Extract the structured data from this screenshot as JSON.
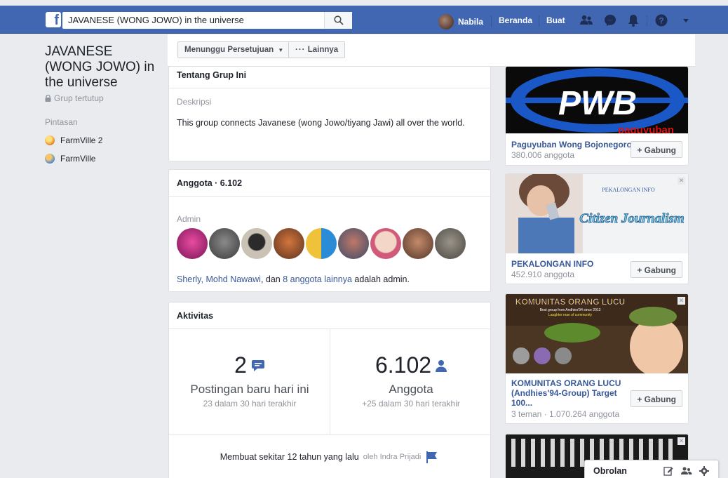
{
  "topbar": {
    "logo": "f",
    "search_value": "JAVANESE (WONG JOWO) in the universe",
    "profile_name": "Nabila",
    "nav_home": "Beranda",
    "nav_create": "Buat",
    "icons": [
      "search-icon",
      "friends-icon",
      "messenger-icon",
      "notifications-icon",
      "help-icon",
      "dropdown-caret-icon"
    ]
  },
  "left": {
    "group_title": "JAVANESE (WONG JOWO) in the universe",
    "group_type": "Grup tertutup",
    "shortcuts_heading": "Pintasan",
    "shortcuts": [
      {
        "label": "FarmVille 2",
        "icon": "farmville2-icon"
      },
      {
        "label": "FarmVille",
        "icon": "farmville-icon"
      }
    ]
  },
  "actions": {
    "pending_button": "Menunggu Persetujuan",
    "more_button": "Lainnya"
  },
  "about": {
    "heading": "Tentang Grup Ini",
    "desc_label": "Deskripsi",
    "desc_text": "This group connects Javanese (wong Jowo/tiyang Jawi) all over the world."
  },
  "members": {
    "heading": "Anggota · 6.102",
    "admin_label": "Admin",
    "admin_names": "Sherly, Mohd Nawawi",
    "and_text": ", dan ",
    "others_link": "8 anggota lainnya",
    "suffix": " adalah admin."
  },
  "activity": {
    "heading": "Aktivitas",
    "posts_count": "2",
    "posts_label": "Postingan baru hari ini",
    "posts_sub": "23 dalam 30 hari terakhir",
    "members_count": "6.102",
    "members_label": "Anggota",
    "members_sub": "+25 dalam 30 hari terakhir",
    "created_text": "Membuat sekitar 12 tahun yang lalu",
    "created_by": "oleh Indra Prijadi"
  },
  "ads": [
    {
      "name": "Paguyuban Wong Bojonegoro",
      "meta": "380.006 anggota",
      "join": "+ Gabung",
      "img_text": "PWB",
      "img_sub": "paguyuban"
    },
    {
      "name": "PEKALONGAN INFO",
      "meta": "452.910 anggota",
      "join": "+ Gabung",
      "img_text": "Citizen Journalism",
      "img_brand": "PEKALONGAN INFO"
    },
    {
      "name": "KOMUNITAS ORANG LUCU (Andhies'94-Group) Target 100...",
      "meta": "3 teman · 1.070.264 anggota",
      "join": "+ Gabung",
      "img_text": "KOMUNITAS ORANG LUCU",
      "img_sub": "Best group from Andhies'94 since 2013",
      "img_sub2": "Laughter man of community"
    }
  ],
  "chat": {
    "label": "Obrolan"
  },
  "colors": {
    "brand": "#4267b2",
    "link": "#385898",
    "background": "#e9ebee"
  }
}
